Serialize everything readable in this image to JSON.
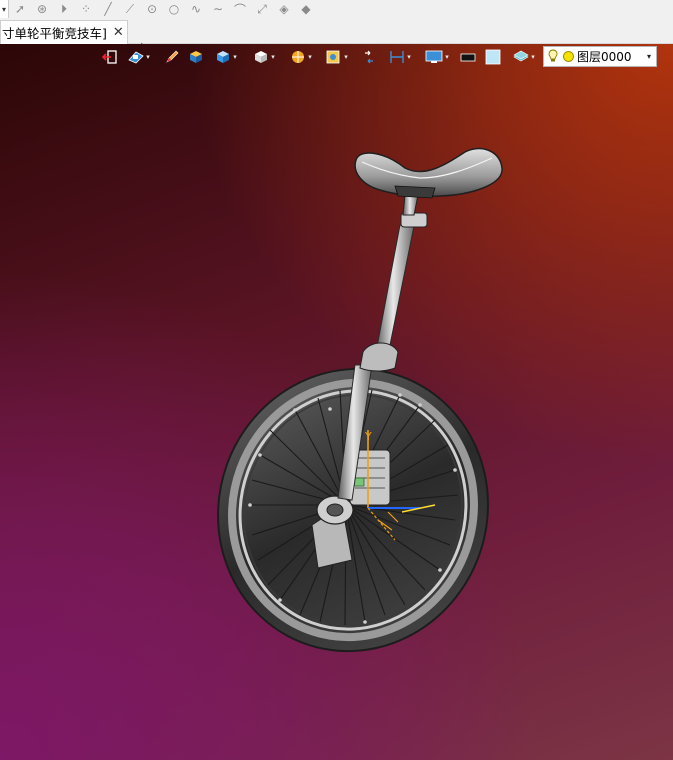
{
  "top_toolbar": {
    "icons": [
      "select-arrow-icon",
      "point-lasso-icon",
      "play-icon",
      "scatter-points-icon",
      "line-icon",
      "line-point-icon",
      "circle-point-icon",
      "circle-icon",
      "wave-icon",
      "arc-icon",
      "pin-line-icon",
      "surface-icon",
      "surface-alt-icon"
    ]
  },
  "tabs": [
    {
      "label": "寸单轮平衡竞技车]",
      "close": "✕"
    }
  ],
  "new_tab": "+",
  "view_toolbar": {
    "layer": {
      "label": "图层0000"
    }
  },
  "colors": {
    "viewport_top_right": "#b1340d",
    "viewport_bottom_left": "#7d1866",
    "viewport_top_left": "#2c0707"
  }
}
